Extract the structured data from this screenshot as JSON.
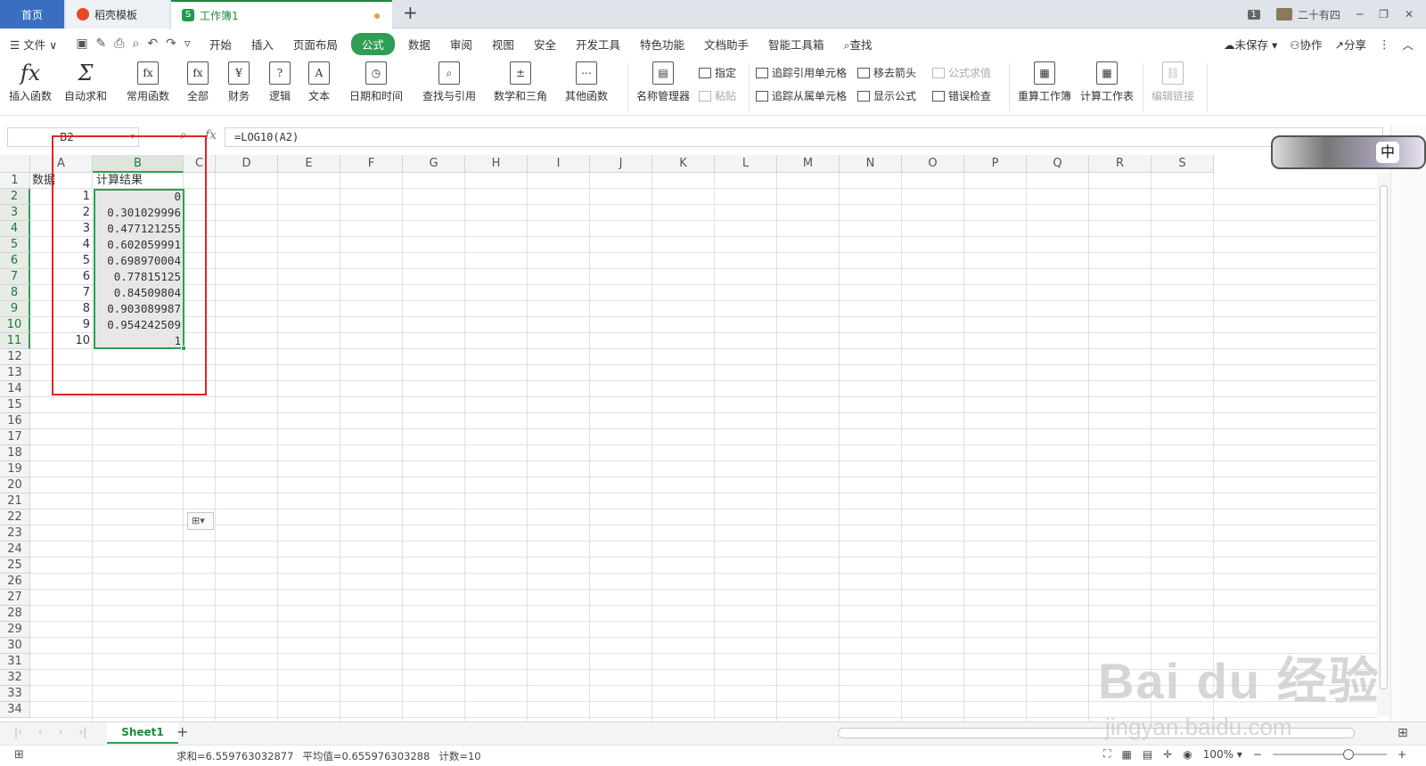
{
  "tabs": {
    "home": "首页",
    "template": "稻壳模板",
    "workbook": "工作簿1",
    "workbook_logo": "S",
    "new_tab": "+"
  },
  "window": {
    "badge": "1",
    "user_name": "二十有四",
    "minimize": "─",
    "restore": "❐",
    "close": "✕"
  },
  "menu": {
    "file": "☰ 文件 ∨",
    "items": [
      "开始",
      "插入",
      "页面布局",
      "公式",
      "数据",
      "审阅",
      "视图",
      "安全",
      "开发工具",
      "特色功能",
      "文档助手",
      "智能工具箱",
      "查找"
    ],
    "active_index": 3,
    "right": {
      "unsaved": "未保存 ▾",
      "collab": "协作",
      "share": "分享",
      "more": "⋮",
      "collapse": "︿"
    }
  },
  "ribbon": {
    "insert_function": "插入函数",
    "autosum": "自动求和",
    "common": "常用函数",
    "all": "全部",
    "finance": "财务",
    "logic": "逻辑",
    "text": "文本",
    "datetime": "日期和时间",
    "lookup": "查找与引用",
    "math": "数学和三角",
    "other": "其他函数",
    "name_manager": "名称管理器",
    "specify": "指定",
    "paste": "粘贴",
    "trace_precedents": "追踪引用单元格",
    "trace_dependents": "追踪从属单元格",
    "remove_arrows": "移去箭头",
    "show_formulas": "显示公式",
    "evaluate": "公式求值",
    "error_check": "错误检查",
    "recalc_book": "重算工作簿",
    "calc_sheet": "计算工作表",
    "edit_links": "编辑链接"
  },
  "formula_bar": {
    "name_box": "B2",
    "fx_label": "fx",
    "formula": "=LOG10(A2)"
  },
  "sheet": {
    "columns": [
      "A",
      "B",
      "C",
      "D",
      "E",
      "F",
      "G",
      "H",
      "I",
      "J",
      "K",
      "L",
      "M",
      "N",
      "O",
      "P",
      "Q",
      "R",
      "S"
    ],
    "row_count": 34,
    "a1": "数据",
    "b1": "计算结果",
    "a_values": [
      "1",
      "2",
      "3",
      "4",
      "5",
      "6",
      "7",
      "8",
      "9",
      "10"
    ],
    "b_values": [
      "0",
      "0.301029996",
      "0.477121255",
      "0.602059991",
      "0.698970004",
      "0.77815125",
      "0.84509804",
      "0.903089987",
      "0.954242509",
      "1"
    ],
    "paste_option": "⊞▾"
  },
  "sheet_tabs": {
    "active": "Sheet1",
    "add": "+",
    "grid_icon": "⊞"
  },
  "status": {
    "sum": "求和=6.559763032877",
    "average": "平均值=0.655976303288",
    "count": "计数=10",
    "zoom": "100% ▾"
  },
  "ime": {
    "label": "中"
  },
  "watermark": {
    "main": "Bai du 经验",
    "sub": "jingyan.baidu.com"
  },
  "colors": {
    "accent": "#2e9e55",
    "home_tab": "#3a6fbf",
    "highlight_box": "#e02424"
  }
}
